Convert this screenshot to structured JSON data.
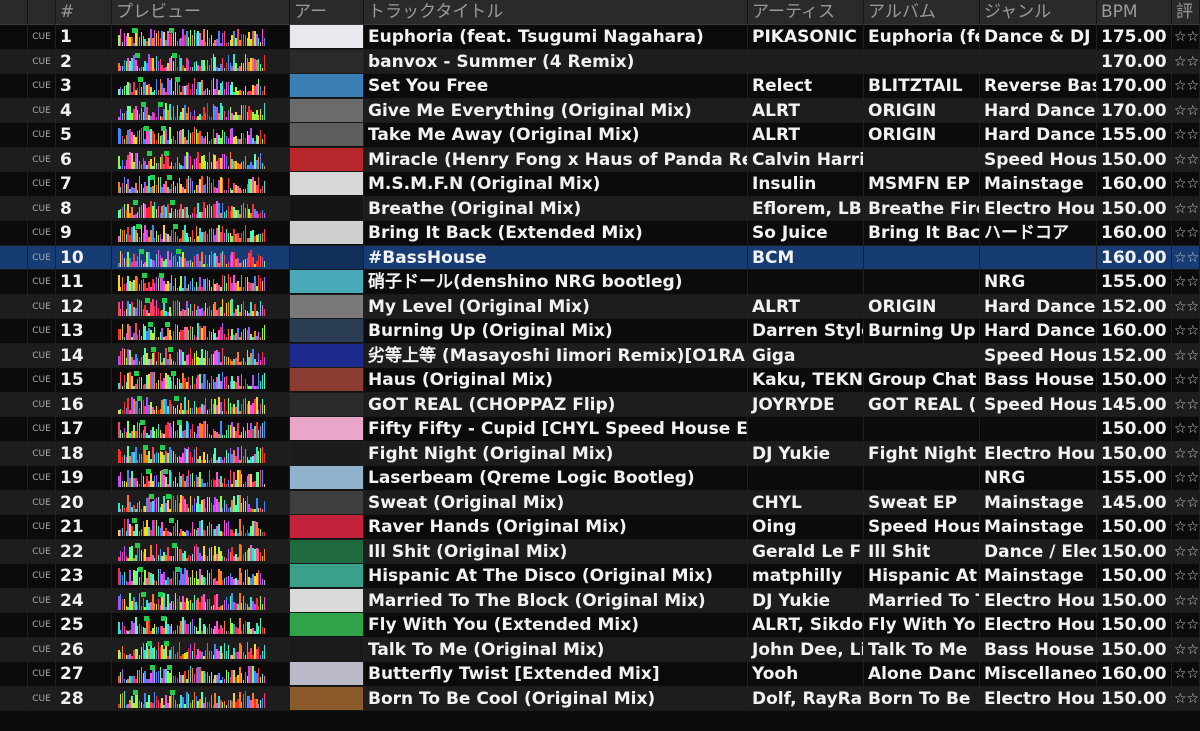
{
  "headers": {
    "col_blank": "",
    "col_cue": "",
    "col_num": "#",
    "col_preview": "プレビュー",
    "col_art": "アー",
    "col_title": "トラックタイトル",
    "col_artist": "アーティス",
    "col_album": "アルバム",
    "col_genre": "ジャンル",
    "col_bpm": "BPM",
    "col_rating": "評"
  },
  "cue_label": "CUE",
  "rating_text": "☆☆",
  "selected_row": 10,
  "tracks": [
    {
      "num": "1",
      "title": "Euphoria (feat. Tsugumi Nagahara)",
      "artist": "PIKASONIC",
      "album": "Euphoria (fe",
      "genre": "Dance & DJ",
      "bpm": "175.00",
      "art_color": "#e8e8ee"
    },
    {
      "num": "2",
      "title": "banvox - Summer (4 Remix)",
      "artist": "",
      "album": "",
      "genre": "",
      "bpm": "170.00",
      "art_color": "#2a2a2a"
    },
    {
      "num": "3",
      "title": "Set You Free",
      "artist": "Relect",
      "album": "BLITZTAIL",
      "genre": "Reverse Bas",
      "bpm": "170.00",
      "art_color": "#3a7fb5"
    },
    {
      "num": "4",
      "title": "Give Me Everything (Original Mix)",
      "artist": "ALRT",
      "album": "ORIGIN",
      "genre": "Hard Dance",
      "bpm": "170.00",
      "art_color": "#6b6b6b"
    },
    {
      "num": "5",
      "title": "Take Me Away (Original Mix)",
      "artist": "ALRT",
      "album": "ORIGIN",
      "genre": "Hard Dance",
      "bpm": "155.00",
      "art_color": "#5e5e5e"
    },
    {
      "num": "6",
      "title": "Miracle (Henry Fong x Haus of Panda Remi",
      "artist": "Calvin Harri",
      "album": "",
      "genre": "Speed Hous",
      "bpm": "150.00",
      "art_color": "#b8272b"
    },
    {
      "num": "7",
      "title": "M.S.M.F.N (Original Mix)",
      "artist": "Insulin",
      "album": "MSMFN EP",
      "genre": "Mainstage",
      "bpm": "160.00",
      "art_color": "#d7d7d7"
    },
    {
      "num": "8",
      "title": "Breathe (Original Mix)",
      "artist": "Eflorem, LB",
      "album": "Breathe Fire",
      "genre": "Electro Hou",
      "bpm": "150.00",
      "art_color": "#141414"
    },
    {
      "num": "9",
      "title": "Bring It Back (Extended Mix)",
      "artist": "So Juice",
      "album": "Bring It Bac",
      "genre": "ハードコア",
      "bpm": "160.00",
      "art_color": "#cfcfcf"
    },
    {
      "num": "10",
      "title": "#BassHouse",
      "artist": "BCM",
      "album": "",
      "genre": "",
      "bpm": "160.00",
      "art_color": "#0f2f5a"
    },
    {
      "num": "11",
      "title": "硝子ドール(denshino NRG bootleg)",
      "artist": "",
      "album": "",
      "genre": "NRG",
      "bpm": "155.00",
      "art_color": "#4aa9b9"
    },
    {
      "num": "12",
      "title": "My Level (Original Mix)",
      "artist": "ALRT",
      "album": "ORIGIN",
      "genre": "Hard Dance",
      "bpm": "152.00",
      "art_color": "#7a7a7a"
    },
    {
      "num": "13",
      "title": "Burning Up (Original Mix)",
      "artist": "Darren Style",
      "album": "Burning Up",
      "genre": "Hard Dance",
      "bpm": "160.00",
      "art_color": "#2a3d52"
    },
    {
      "num": "14",
      "title": "劣等上等 (Masayoshi Iimori Remix)[O1RA",
      "artist": "Giga",
      "album": "",
      "genre": "Speed Hous",
      "bpm": "152.00",
      "art_color": "#1b2a8c"
    },
    {
      "num": "15",
      "title": "Haus (Original Mix)",
      "artist": "Kaku, TEKNi",
      "album": "Group Chat",
      "genre": "Bass House",
      "bpm": "150.00",
      "art_color": "#8a3b32"
    },
    {
      "num": "16",
      "title": "GOT REAL (CHOPPAZ Flip)",
      "artist": "JOYRYDE",
      "album": "GOT REAL (",
      "genre": "Speed Hous",
      "bpm": "145.00",
      "art_color": "#2b2b2b"
    },
    {
      "num": "17",
      "title": "Fifty Fifty - Cupid [CHYL Speed House Edit]",
      "artist": "",
      "album": "",
      "genre": "",
      "bpm": "150.00",
      "art_color": "#e9a6c8"
    },
    {
      "num": "18",
      "title": "Fight Night (Original Mix)",
      "artist": "DJ Yukie",
      "album": "Fight Night",
      "genre": "Electro Hou",
      "bpm": "150.00",
      "art_color": "#1c1c1c"
    },
    {
      "num": "19",
      "title": "Laserbeam (Qreme Logic Bootleg)",
      "artist": "",
      "album": "",
      "genre": "NRG",
      "bpm": "155.00",
      "art_color": "#8fb3cc"
    },
    {
      "num": "20",
      "title": "Sweat (Original Mix)",
      "artist": "CHYL",
      "album": "Sweat EP",
      "genre": "Mainstage",
      "bpm": "145.00",
      "art_color": "#3f3f3f"
    },
    {
      "num": "21",
      "title": "Raver Hands (Original Mix)",
      "artist": "Oing",
      "album": "Speed Hous",
      "genre": "Mainstage",
      "bpm": "150.00",
      "art_color": "#c2233a"
    },
    {
      "num": "22",
      "title": "Ill Shit (Original Mix)",
      "artist": "Gerald Le F",
      "album": "Ill Shit",
      "genre": "Dance / Elec",
      "bpm": "150.00",
      "art_color": "#1f6b3f"
    },
    {
      "num": "23",
      "title": "Hispanic At The Disco (Original Mix)",
      "artist": "matphilly",
      "album": "Hispanic At",
      "genre": "Mainstage",
      "bpm": "150.00",
      "art_color": "#3aa08a"
    },
    {
      "num": "24",
      "title": "Married To The Block (Original Mix)",
      "artist": "DJ Yukie",
      "album": "Married To T",
      "genre": "Electro Hou",
      "bpm": "150.00",
      "art_color": "#d9d9d9"
    },
    {
      "num": "25",
      "title": "Fly With You (Extended Mix)",
      "artist": "ALRT, Sikdo",
      "album": "Fly With Yo",
      "genre": "Electro Hou",
      "bpm": "150.00",
      "art_color": "#2fa24a"
    },
    {
      "num": "26",
      "title": "Talk To Me (Original Mix)",
      "artist": "John Dee, Li",
      "album": "Talk To Me",
      "genre": "Bass House",
      "bpm": "150.00",
      "art_color": "#1a1a1a"
    },
    {
      "num": "27",
      "title": "Butterfly Twist [Extended Mix]",
      "artist": "Yooh",
      "album": "Alone Danc",
      "genre": "Miscellaneo",
      "bpm": "160.00",
      "art_color": "#b9b9c8"
    },
    {
      "num": "28",
      "title": "Born To Be Cool (Original Mix)",
      "artist": "Dolf, RayRa",
      "album": "Born To Be",
      "genre": "Electro Hou",
      "bpm": "150.00",
      "art_color": "#8b5a2b"
    }
  ]
}
